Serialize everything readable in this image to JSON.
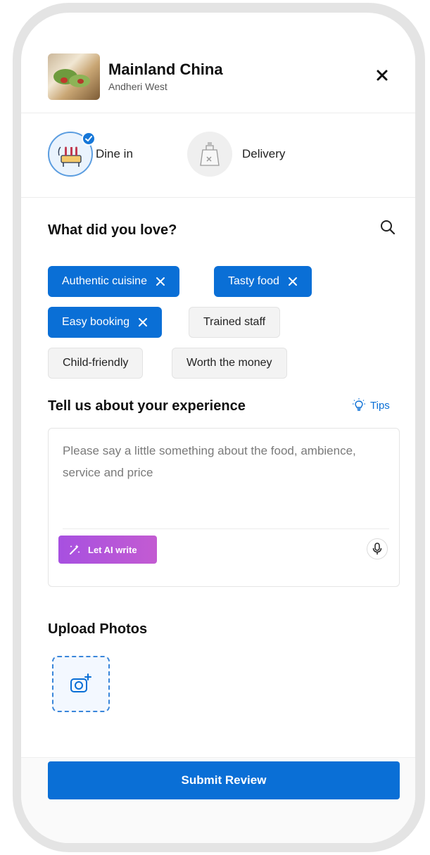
{
  "restaurant": {
    "name": "Mainland China",
    "location": "Andheri West",
    "thumbnail_icon": "food-photo"
  },
  "header": {
    "close_icon": "close-icon"
  },
  "order_type": {
    "selected": "Dine in",
    "options": [
      {
        "label": "Dine in",
        "icon": "dine-in-icon",
        "selected": true
      },
      {
        "label": "Delivery",
        "icon": "delivery-bag-icon",
        "selected": false
      }
    ]
  },
  "love_section": {
    "heading": "What did you love?",
    "search_icon": "search-icon",
    "chips": [
      {
        "label": "Authentic cuisine",
        "selected": true
      },
      {
        "label": "Tasty food",
        "selected": true
      },
      {
        "label": "Easy booking",
        "selected": true
      },
      {
        "label": "Trained staff",
        "selected": false
      },
      {
        "label": "Child-friendly",
        "selected": false
      },
      {
        "label": "Worth the money",
        "selected": false
      }
    ]
  },
  "experience": {
    "heading": "Tell us about your experience",
    "tips_label": "Tips",
    "placeholder": "Please say a little something about the food, ambience, service and price",
    "ai_button_label": "Let AI write",
    "mic_icon": "microphone-icon"
  },
  "photos": {
    "heading": "Upload Photos",
    "upload_icon": "camera-add-icon"
  },
  "submit_label": "Submit Review",
  "colors": {
    "primary": "#0a6fd6",
    "ai_gradient_start": "#a750e0",
    "ai_gradient_end": "#c35bd2",
    "chip_unselected_bg": "#f3f3f3"
  }
}
